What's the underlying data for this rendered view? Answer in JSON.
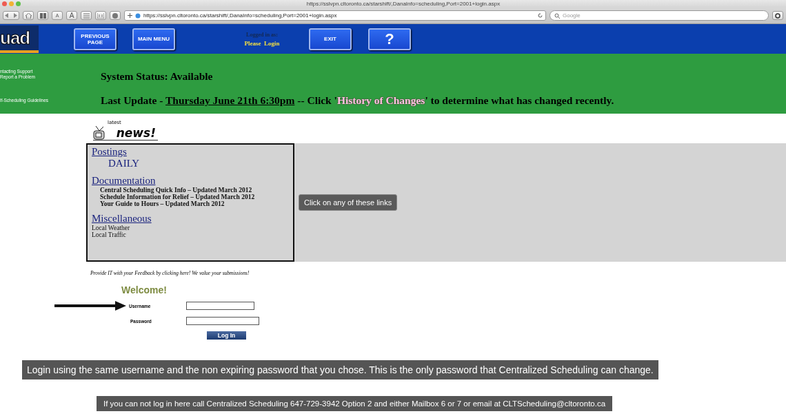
{
  "browser": {
    "title": "https://sslvpn.cltoronto.ca/starshift/,DanaInfo=scheduling,Port=2001+login.aspx",
    "text_size_buttons": [
      "A",
      "A"
    ],
    "url": "https://sslvpn.cltoronto.ca/starshift/,DanaInfo=scheduling,Port=2001+login.aspx",
    "search_placeholder": "Google"
  },
  "nav": {
    "logo": "uad",
    "buttons": [
      {
        "label": "PREVIOUS PAGE",
        "kind": "text"
      },
      {
        "label": "MAIN MENU",
        "kind": "text"
      },
      {
        "label": "EXIT",
        "kind": "text"
      },
      {
        "label": "?",
        "kind": "help"
      }
    ],
    "logged_in_label": "Logged in as:",
    "login_link": "Please  Login"
  },
  "sidebar": {
    "items": [
      "ntacting Support\n Report a Problem",
      "lf-Scheduling Guidelines"
    ]
  },
  "status": "System Status: Available",
  "last_update": {
    "prefix": "Last Update - ",
    "date": "Thursday June 21th 6:30pm",
    "middle": " -- Click '",
    "link": "History of Changes",
    "suffix": "' to determine what has changed recently."
  },
  "news": {
    "logo_small": "latest",
    "logo_big": "news!",
    "sections": [
      {
        "heading": "Postings",
        "kind": "large",
        "links": [
          "DAILY"
        ]
      },
      {
        "heading": "Documentation",
        "kind": "bold",
        "links": [
          "Central Scheduling Quick Info – Updated March 2012",
          "Schedule Information for Relief – Updated March 2012",
          "Your Guide to Hours – Updated March 2012"
        ]
      },
      {
        "heading": "Miscellaneous",
        "kind": "plain",
        "links": [
          "Local Weather",
          "Local Traffic"
        ]
      }
    ],
    "tooltip": "Click on any of these links"
  },
  "feedback": "Provide IT with your Feedback by clicking here! We value your submissions!",
  "login": {
    "welcome": "Welcome!",
    "username_label": "Username",
    "password_label": "Password",
    "button": "Log In"
  },
  "captions": [
    "Login using the same username and the non expiring password that you chose. This is the only password that Centralized Scheduling can change.",
    "If you can not log in here call Centralized Scheduling 647-729-3942 Option 2 and either Mailbox 6 or 7 or email at CLTScheduling@cltoronto.ca"
  ]
}
